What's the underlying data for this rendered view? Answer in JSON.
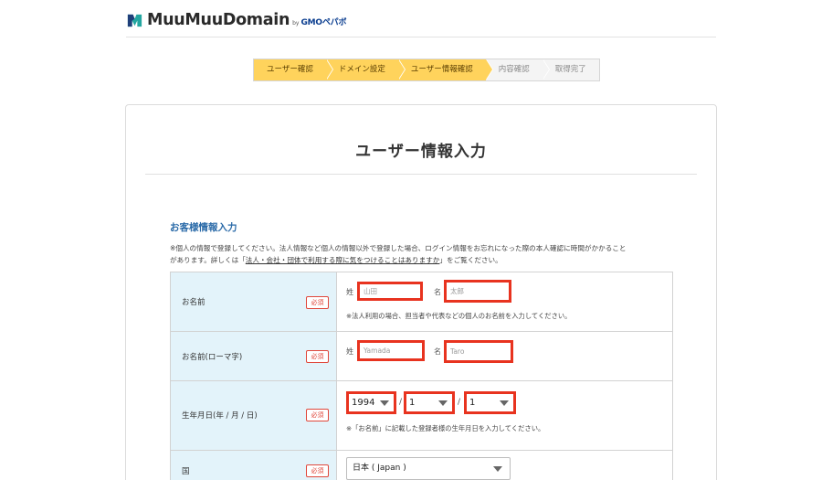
{
  "header": {
    "logo_text": "MuuMuuDomain",
    "logo_by": "by",
    "logo_gmo": "GMOペパボ"
  },
  "steps": [
    {
      "label": "ユーザー確認",
      "active": true
    },
    {
      "label": "ドメイン設定",
      "active": true
    },
    {
      "label": "ユーザー情報確認",
      "active": true
    },
    {
      "label": "内容確認",
      "active": false
    },
    {
      "label": "取得完了",
      "active": false
    }
  ],
  "page": {
    "title": "ユーザー情報入力"
  },
  "section": {
    "title": "お客様情報入力",
    "note_line1": "※個人の情報で登録してください。法人情報など個人の情報以外で登録した場合、ログイン情報をお忘れになった際の本人確認に時間がかかること",
    "note_line2_pre": "があります。詳しくは「",
    "note_link": "法人・会社・団体で利用する際に気をつけることはありますか",
    "note_line2_post": "」をご覧ください。"
  },
  "form": {
    "required_label": "必須",
    "name": {
      "label": "お名前",
      "last_label": "姓",
      "last_placeholder": "山田",
      "first_label": "名",
      "first_placeholder": "太郎",
      "hint": "※法人利用の場合、担当者や代表などの個人のお名前を入力してください。"
    },
    "name_roman": {
      "label": "お名前(ローマ字)",
      "last_label": "姓",
      "last_placeholder": "Yamada",
      "first_label": "名",
      "first_placeholder": "Taro"
    },
    "birthday": {
      "label": "生年月日(年 / 月 / 日)",
      "year": "1994",
      "month": "1",
      "day": "1",
      "separator": "/",
      "hint": "※「お名前」に記載した登録者様の生年月日を入力してください。"
    },
    "country": {
      "label": "国",
      "value": "日本 ( Japan )"
    }
  },
  "colors": {
    "step_active": "#ffd35c",
    "row_head_bg": "#e3f3fa",
    "highlight_border": "#e8331f",
    "required": "#e0473b",
    "section_title": "#2a6aa8"
  }
}
